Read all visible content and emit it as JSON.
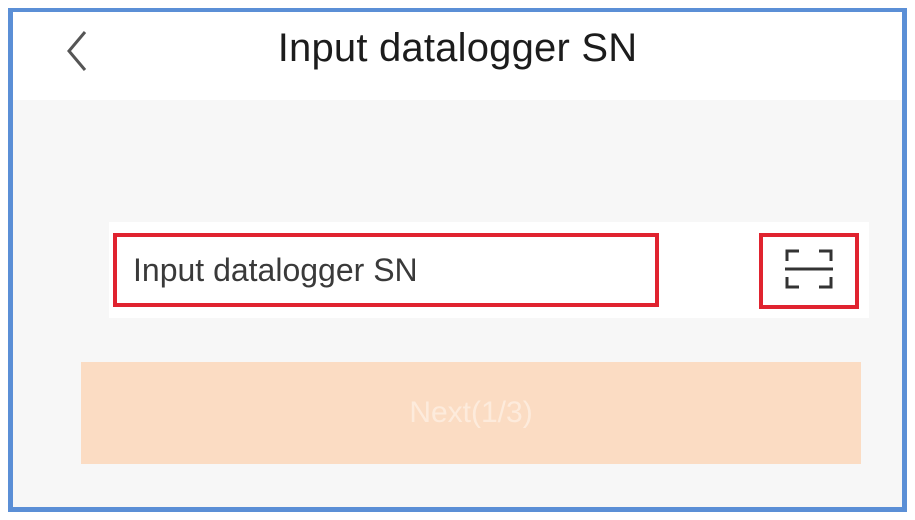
{
  "header": {
    "title": "Input datalogger SN",
    "back_icon": "chevron-left-icon"
  },
  "sn_field": {
    "placeholder": "Input datalogger SN",
    "value": ""
  },
  "scan_button": {
    "icon": "scan-icon"
  },
  "next_button": {
    "label": "Next(1/3)"
  },
  "colors": {
    "frame_border": "#5b8fd6",
    "highlight_border": "#e0232f",
    "next_button_bg": "#fbdcc3",
    "page_bg": "#f7f7f7"
  }
}
